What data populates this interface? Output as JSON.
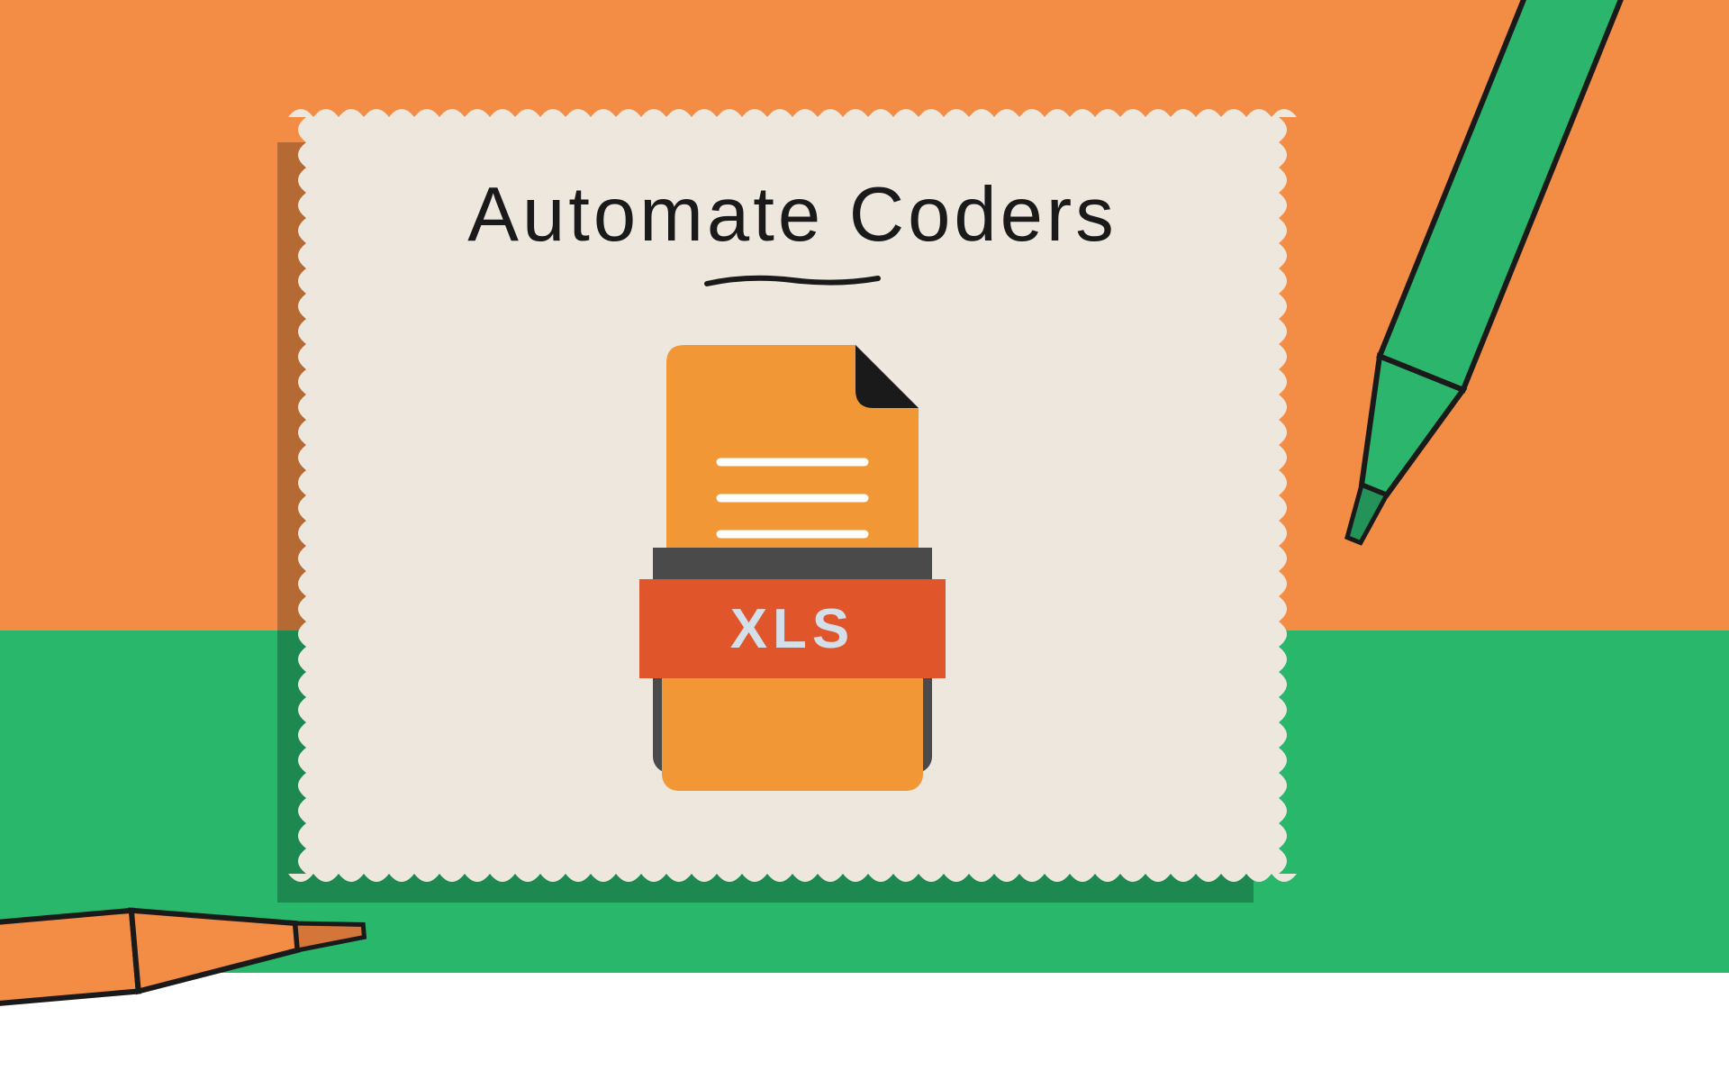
{
  "title": "Automate Coders",
  "file_label": "XLS",
  "colors": {
    "orange_bg": "#F38D45",
    "green_bg": "#28B76B",
    "card": "#EEE7DD",
    "file_orange": "#F19736",
    "file_band": "#E0562A",
    "file_text": "#D4DFEA",
    "pen_green": "#2BB56D",
    "pen_orange": "#F38D45"
  }
}
